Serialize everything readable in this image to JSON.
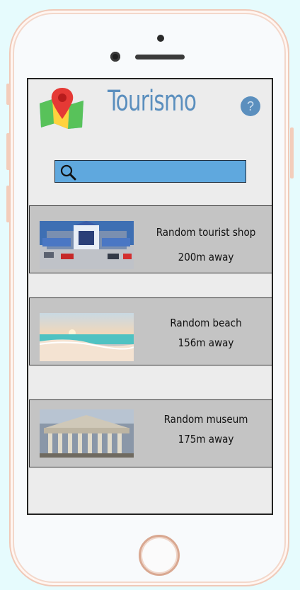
{
  "app": {
    "title": "Tourismo",
    "help_label": "?"
  },
  "search": {
    "value": "",
    "placeholder": ""
  },
  "places": [
    {
      "name": "Random tourist shop",
      "distance": "200m away",
      "image": "tourist-shop-photo"
    },
    {
      "name": "Random beach",
      "distance": "156m away",
      "image": "beach-photo"
    },
    {
      "name": "Random museum",
      "distance": "175m away",
      "image": "museum-photo"
    }
  ],
  "colors": {
    "accent": "#5b8fbe",
    "search_bg": "#5fa8de",
    "card_bg": "#c4c4c4",
    "screen_bg": "#ececec"
  }
}
